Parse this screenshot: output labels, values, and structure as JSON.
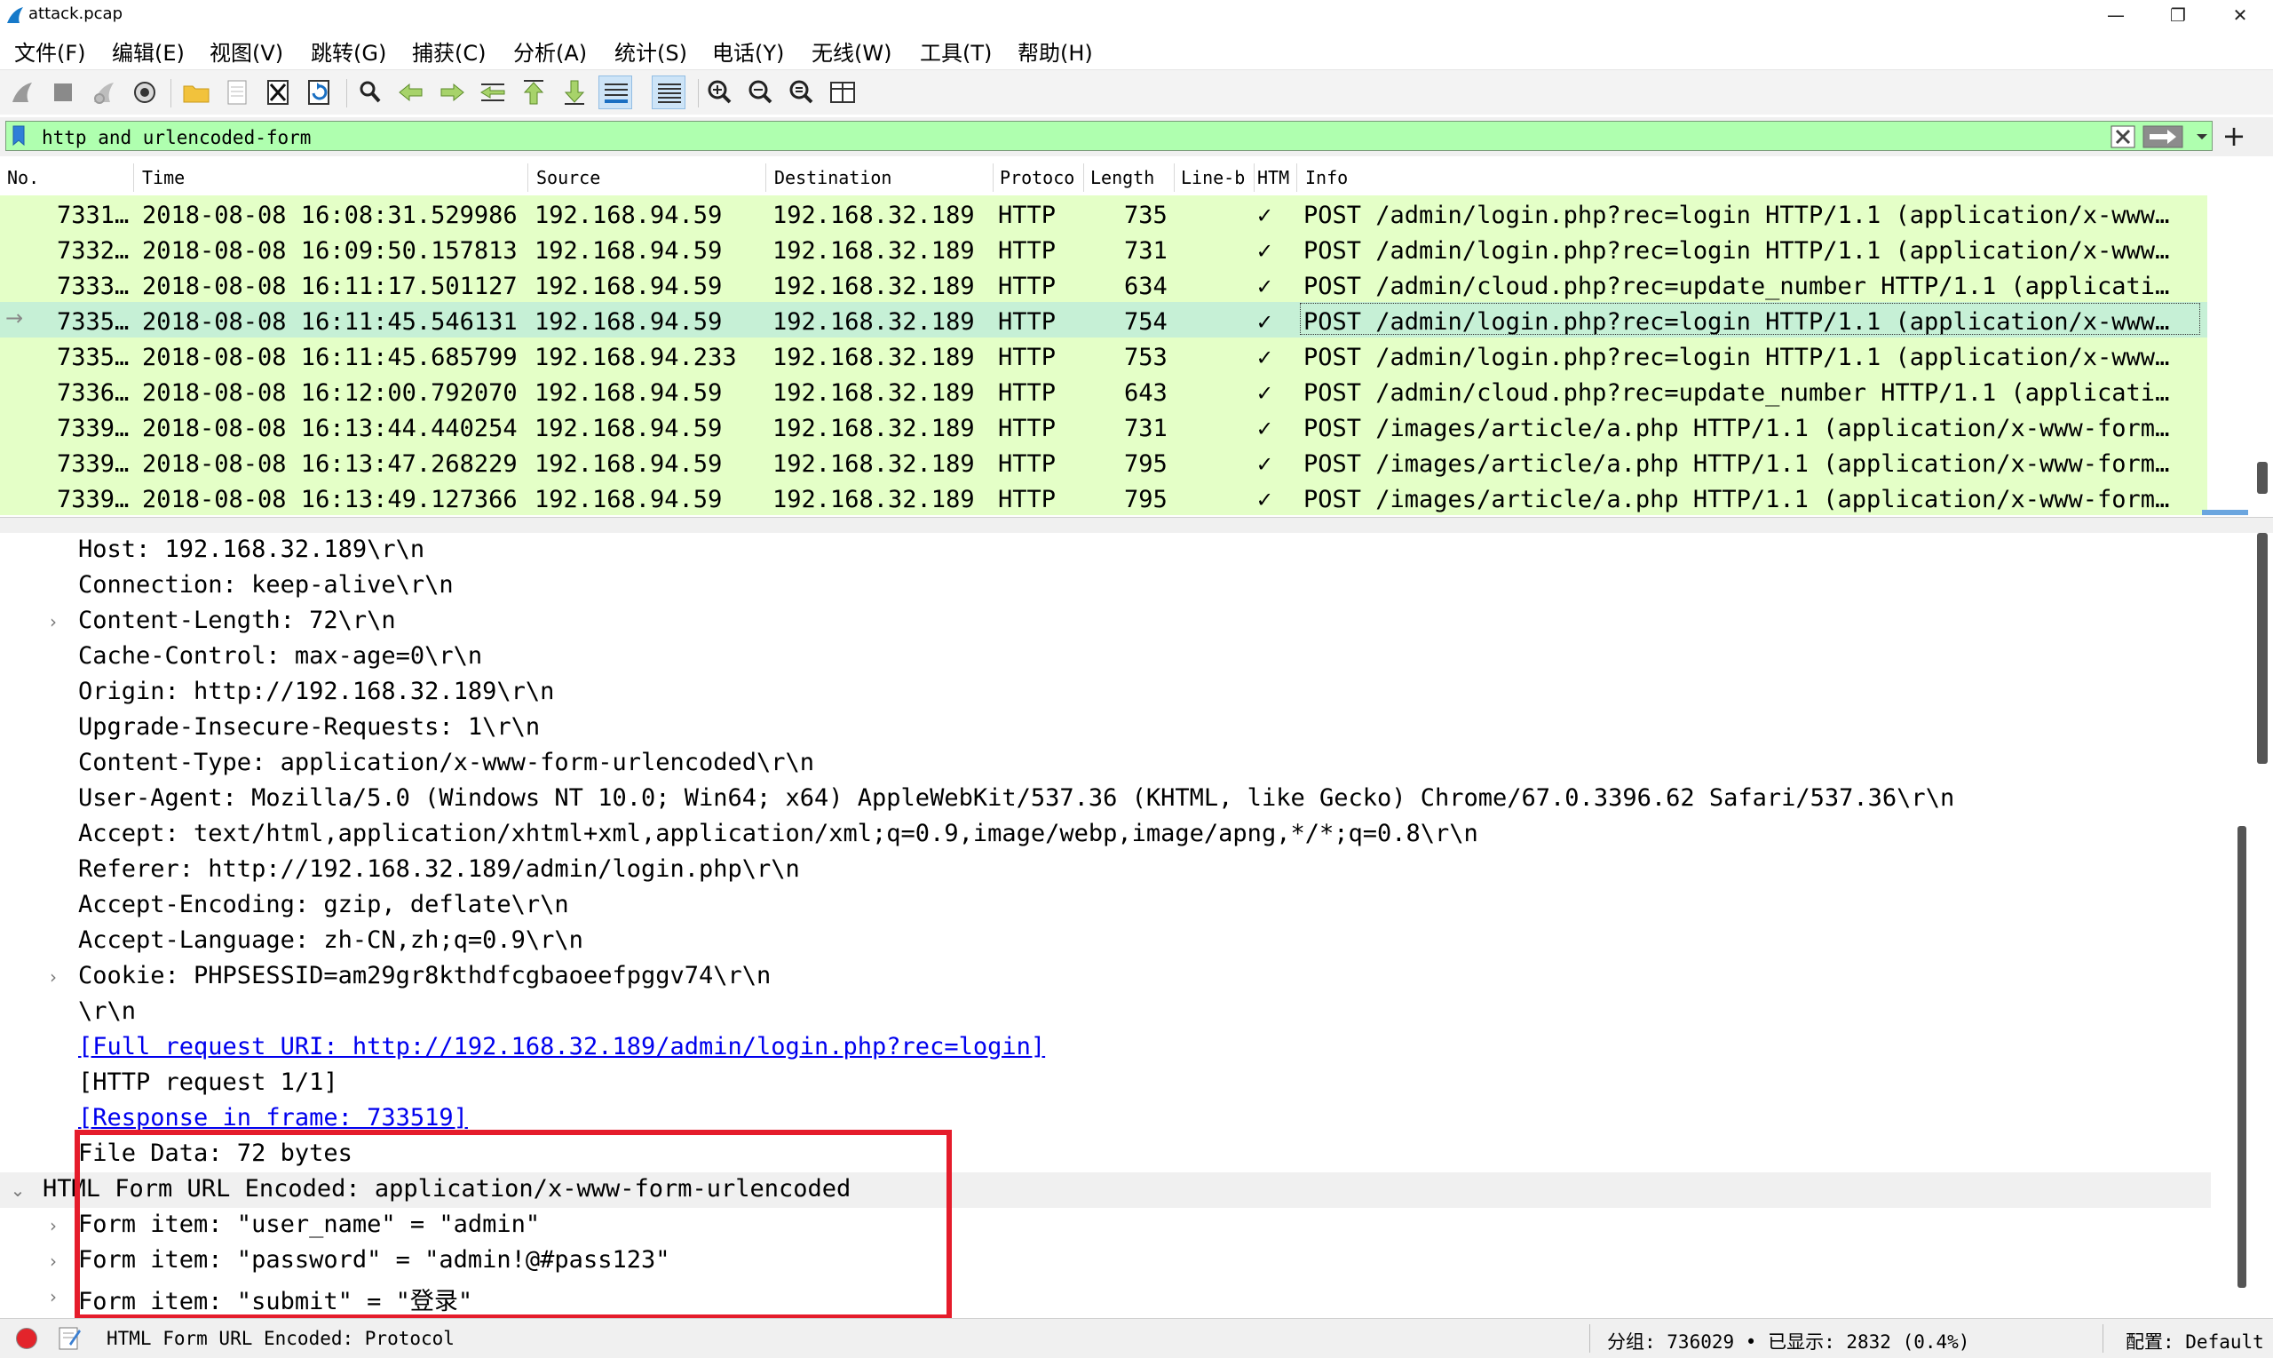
{
  "window": {
    "title": "attack.pcap",
    "controls": {
      "minimize": "—",
      "maximize": "❐",
      "close": "✕"
    }
  },
  "menu": [
    {
      "label": "文件(F)"
    },
    {
      "label": "编辑(E)"
    },
    {
      "label": "视图(V)"
    },
    {
      "label": "跳转(G)"
    },
    {
      "label": "捕获(C)"
    },
    {
      "label": "分析(A)"
    },
    {
      "label": "统计(S)"
    },
    {
      "label": "电话(Y)"
    },
    {
      "label": "无线(W)"
    },
    {
      "label": "工具(T)"
    },
    {
      "label": "帮助(H)"
    }
  ],
  "toolbar": [
    {
      "icon": "shark-fin-start-icon"
    },
    {
      "icon": "stop-capture-icon"
    },
    {
      "icon": "restart-capture-icon"
    },
    {
      "icon": "capture-options-icon"
    },
    {
      "icon": "open-file-icon"
    },
    {
      "icon": "save-file-icon"
    },
    {
      "icon": "close-file-icon"
    },
    {
      "icon": "reload-file-icon"
    },
    {
      "icon": "find-packet-icon"
    },
    {
      "icon": "go-back-icon"
    },
    {
      "icon": "go-forward-icon"
    },
    {
      "icon": "go-to-packet-icon"
    },
    {
      "icon": "go-first-icon"
    },
    {
      "icon": "go-last-icon"
    },
    {
      "icon": "autoscroll-icon"
    },
    {
      "icon": "colorize-icon"
    },
    {
      "icon": "zoom-in-icon"
    },
    {
      "icon": "zoom-out-icon"
    },
    {
      "icon": "zoom-normal-icon"
    },
    {
      "icon": "resize-columns-icon"
    }
  ],
  "filter": {
    "value": "http and urlencoded-form",
    "color": "#afffaf"
  },
  "packet_list": {
    "columns": [
      "No.",
      "Time",
      "Source",
      "Destination",
      "Protoco",
      "Length",
      "Line-b",
      "HTM",
      "Info"
    ],
    "rows": [
      {
        "no": "7331…",
        "time": "2018-08-08 16:08:31.529986",
        "src": "192.168.94.59",
        "dst": "192.168.32.189",
        "proto": "HTTP",
        "len": "735",
        "check": "✓",
        "info": "POST /admin/login.php?rec=login HTTP/1.1  (application/x-www…",
        "selected": false
      },
      {
        "no": "7332…",
        "time": "2018-08-08 16:09:50.157813",
        "src": "192.168.94.59",
        "dst": "192.168.32.189",
        "proto": "HTTP",
        "len": "731",
        "check": "✓",
        "info": "POST /admin/login.php?rec=login HTTP/1.1  (application/x-www…",
        "selected": false
      },
      {
        "no": "7333…",
        "time": "2018-08-08 16:11:17.501127",
        "src": "192.168.94.59",
        "dst": "192.168.32.189",
        "proto": "HTTP",
        "len": "634",
        "check": "✓",
        "info": "POST /admin/cloud.php?rec=update_number HTTP/1.1  (applicati…",
        "selected": false
      },
      {
        "no": "7335…",
        "time": "2018-08-08 16:11:45.546131",
        "src": "192.168.94.59",
        "dst": "192.168.32.189",
        "proto": "HTTP",
        "len": "754",
        "check": "✓",
        "info": "POST /admin/login.php?rec=login HTTP/1.1  (application/x-www…",
        "selected": true
      },
      {
        "no": "7335…",
        "time": "2018-08-08 16:11:45.685799",
        "src": "192.168.94.233",
        "dst": "192.168.32.189",
        "proto": "HTTP",
        "len": "753",
        "check": "✓",
        "info": "POST /admin/login.php?rec=login HTTP/1.1  (application/x-www…",
        "selected": false
      },
      {
        "no": "7336…",
        "time": "2018-08-08 16:12:00.792070",
        "src": "192.168.94.59",
        "dst": "192.168.32.189",
        "proto": "HTTP",
        "len": "643",
        "check": "✓",
        "info": "POST /admin/cloud.php?rec=update_number HTTP/1.1  (applicati…",
        "selected": false
      },
      {
        "no": "7339…",
        "time": "2018-08-08 16:13:44.440254",
        "src": "192.168.94.59",
        "dst": "192.168.32.189",
        "proto": "HTTP",
        "len": "731",
        "check": "✓",
        "info": "POST /images/article/a.php HTTP/1.1  (application/x-www-form…",
        "selected": false
      },
      {
        "no": "7339…",
        "time": "2018-08-08 16:13:47.268229",
        "src": "192.168.94.59",
        "dst": "192.168.32.189",
        "proto": "HTTP",
        "len": "795",
        "check": "✓",
        "info": "POST /images/article/a.php HTTP/1.1  (application/x-www-form…",
        "selected": false
      },
      {
        "no": "7339…",
        "time": "2018-08-08 16:13:49.127366",
        "src": "192.168.94.59",
        "dst": "192.168.32.189",
        "proto": "HTTP",
        "len": "795",
        "check": "✓",
        "info": "POST /images/article/a.php HTTP/1.1  (application/x-www-form…",
        "selected": false
      }
    ],
    "row_color": "#e4ffc7",
    "selected_color": "#c6f0d6"
  },
  "details": {
    "lines": [
      {
        "text": "Host: 192.168.32.189\\r\\n",
        "expander": ""
      },
      {
        "text": "Connection: keep-alive\\r\\n",
        "expander": ""
      },
      {
        "text": "Content-Length: 72\\r\\n",
        "expander": "›"
      },
      {
        "text": "Cache-Control: max-age=0\\r\\n",
        "expander": ""
      },
      {
        "text": "Origin: http://192.168.32.189\\r\\n",
        "expander": ""
      },
      {
        "text": "Upgrade-Insecure-Requests: 1\\r\\n",
        "expander": ""
      },
      {
        "text": "Content-Type: application/x-www-form-urlencoded\\r\\n",
        "expander": ""
      },
      {
        "text": "User-Agent: Mozilla/5.0 (Windows NT 10.0; Win64; x64) AppleWebKit/537.36 (KHTML, like Gecko) Chrome/67.0.3396.62 Safari/537.36\\r\\n",
        "expander": ""
      },
      {
        "text": "Accept: text/html,application/xhtml+xml,application/xml;q=0.9,image/webp,image/apng,*/*;q=0.8\\r\\n",
        "expander": ""
      },
      {
        "text": "Referer: http://192.168.32.189/admin/login.php\\r\\n",
        "expander": ""
      },
      {
        "text": "Accept-Encoding: gzip, deflate\\r\\n",
        "expander": ""
      },
      {
        "text": "Accept-Language: zh-CN,zh;q=0.9\\r\\n",
        "expander": ""
      },
      {
        "text": "Cookie: PHPSESSID=am29gr8kthdfcgbaoeefpggv74\\r\\n",
        "expander": "›"
      },
      {
        "text": "\\r\\n",
        "expander": ""
      },
      {
        "text": "[Full request URI: http://192.168.32.189/admin/login.php?rec=login]",
        "expander": "",
        "link": true
      },
      {
        "text": "[HTTP request 1/1]",
        "expander": ""
      },
      {
        "text": "[Response in frame: 733519]",
        "expander": "",
        "link": true
      },
      {
        "text": "File Data: 72 bytes",
        "expander": ""
      },
      {
        "text": "HTML Form URL Encoded: application/x-www-form-urlencoded",
        "expander": "⌄",
        "top": true
      },
      {
        "text": "Form item: \"user_name\" = \"admin\"",
        "expander": "›"
      },
      {
        "text": "Form item: \"password\" = \"admin!@#pass123\"",
        "expander": "›"
      },
      {
        "text": "Form item: \"submit\" = \"登录\"",
        "expander": "›"
      }
    ],
    "highlight_color": "#e51c2b"
  },
  "status": {
    "text": "HTML Form URL Encoded: Protocol",
    "counts": "分组: 736029 • 已显示: 2832 (0.4%)",
    "profile": "配置: Default"
  }
}
